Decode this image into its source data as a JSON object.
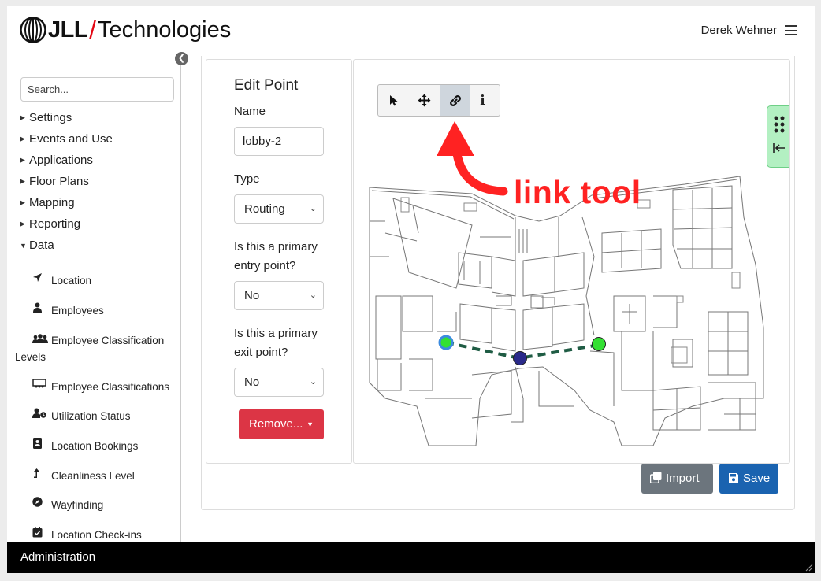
{
  "header": {
    "logo_brand": "JLL",
    "logo_slash": "/",
    "logo_product": "Technologies",
    "user_name": "Derek Wehner"
  },
  "sidebar": {
    "search_placeholder": "Search...",
    "sections": [
      {
        "label": "Settings",
        "expanded": false
      },
      {
        "label": "Events and Use",
        "expanded": false
      },
      {
        "label": "Applications",
        "expanded": false
      },
      {
        "label": "Floor Plans",
        "expanded": false
      },
      {
        "label": "Mapping",
        "expanded": false
      },
      {
        "label": "Reporting",
        "expanded": false
      },
      {
        "label": "Data",
        "expanded": true
      }
    ],
    "data_items": [
      {
        "label": "Location",
        "icon": "location-arrow-icon"
      },
      {
        "label": "Employees",
        "icon": "user-icon"
      },
      {
        "label": "Employee Classification Levels",
        "icon": "users-icon"
      },
      {
        "label": "Employee Classifications",
        "icon": "chalkboard-users-icon"
      },
      {
        "label": "Utilization Status",
        "icon": "user-clock-icon"
      },
      {
        "label": "Location Bookings",
        "icon": "address-book-icon"
      },
      {
        "label": "Cleanliness Level",
        "icon": "level-up-icon"
      },
      {
        "label": "Wayfinding",
        "icon": "compass-icon"
      },
      {
        "label": "Location Check-ins",
        "icon": "calendar-check-icon"
      }
    ]
  },
  "edit_point": {
    "title": "Edit Point",
    "name_label": "Name",
    "name_value": "lobby-2",
    "type_label": "Type",
    "type_value": "Routing",
    "entry_label_1": "Is this a primary",
    "entry_label_2": "entry point?",
    "entry_value": "No",
    "exit_label_1": "Is this a primary",
    "exit_label_2": "exit point?",
    "exit_value": "No",
    "remove_label": "Remove..."
  },
  "map": {
    "tools": [
      "select-tool",
      "move-tool",
      "link-tool",
      "info-tool"
    ],
    "active_tool": "link-tool",
    "info_glyph": "i",
    "annotation": "link tool",
    "annotation_color": "#f22222",
    "route_color": "#1f5c44",
    "node_colors": {
      "endpoint": "#33e033",
      "midpoint": "#2a2a8a",
      "selected_ring": "#3b8be0"
    }
  },
  "actions": {
    "import_label": "Import",
    "save_label": "Save"
  },
  "footer": {
    "label": "Administration"
  }
}
